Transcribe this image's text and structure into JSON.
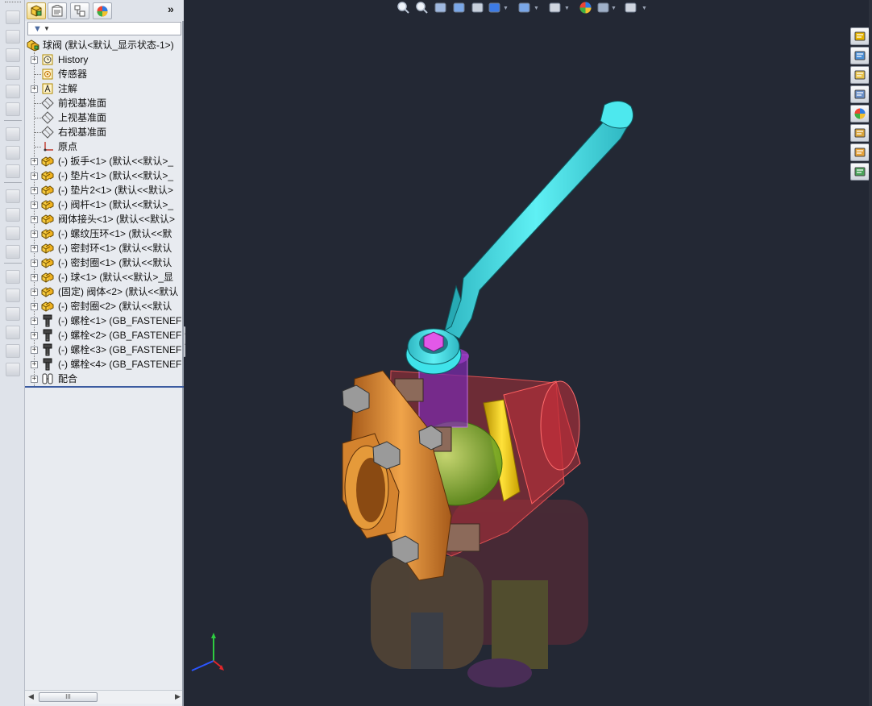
{
  "feature_manager": {
    "tabs": [
      "featuremanager-tree-icon",
      "propertymanager-icon",
      "configurationmanager-icon",
      "displaymanager-icon"
    ],
    "expand_symbol": "»",
    "filter_icon": "funnel-icon",
    "root": "球阀 (默认<默认_显示状态-1>)",
    "items": [
      {
        "label": "History",
        "icon": "history-icon",
        "expandable": true
      },
      {
        "label": "传感器",
        "icon": "sensor-icon",
        "expandable": false
      },
      {
        "label": "注解",
        "icon": "annotation-icon",
        "expandable": true
      },
      {
        "label": "前视基准面",
        "icon": "plane-icon",
        "expandable": false
      },
      {
        "label": "上视基准面",
        "icon": "plane-icon",
        "expandable": false
      },
      {
        "label": "右视基准面",
        "icon": "plane-icon",
        "expandable": false
      },
      {
        "label": "原点",
        "icon": "origin-icon",
        "expandable": false
      },
      {
        "label": "(-) 扳手<1> (默认<<默认>_",
        "icon": "part-icon",
        "expandable": true
      },
      {
        "label": "(-) 垫片<1> (默认<<默认>_",
        "icon": "part-icon",
        "expandable": true
      },
      {
        "label": "(-) 垫片2<1> (默认<<默认>",
        "icon": "part-icon",
        "expandable": true
      },
      {
        "label": "(-) 阀杆<1> (默认<<默认>_",
        "icon": "part-icon",
        "expandable": true
      },
      {
        "label": "阀体接头<1> (默认<<默认>",
        "icon": "part-icon",
        "expandable": true
      },
      {
        "label": "(-) 螺纹压环<1> (默认<<默",
        "icon": "part-icon",
        "expandable": true
      },
      {
        "label": "(-) 密封环<1> (默认<<默认",
        "icon": "part-icon",
        "expandable": true
      },
      {
        "label": "(-) 密封圈<1> (默认<<默认",
        "icon": "part-icon",
        "expandable": true
      },
      {
        "label": "(-) 球<1> (默认<<默认>_显",
        "icon": "part-icon",
        "expandable": true
      },
      {
        "label": "(固定) 阀体<2> (默认<<默认",
        "icon": "part-icon",
        "expandable": true
      },
      {
        "label": "(-) 密封圈<2> (默认<<默认",
        "icon": "part-icon",
        "expandable": true
      },
      {
        "label": "(-) 螺栓<1> (GB_FASTENEF",
        "icon": "bolt-icon",
        "expandable": true
      },
      {
        "label": "(-) 螺栓<2> (GB_FASTENEF",
        "icon": "bolt-icon",
        "expandable": true
      },
      {
        "label": "(-) 螺栓<3> (GB_FASTENEF",
        "icon": "bolt-icon",
        "expandable": true
      },
      {
        "label": "(-) 螺栓<4> (GB_FASTENEF",
        "icon": "bolt-icon",
        "expandable": true
      },
      {
        "label": "配合",
        "icon": "mates-icon",
        "expandable": true
      }
    ],
    "scroll_thumb": "III"
  },
  "view_toolbar": {
    "buttons": [
      "zoom-to-fit-icon",
      "zoom-to-area-icon",
      "previous-view-icon",
      "section-view-icon",
      "dynamic-annotation-icon",
      "view-orientation-icon",
      "display-style-icon",
      "hide-show-icon",
      "edit-appearance-icon",
      "apply-scene-icon",
      "view-settings-icon"
    ]
  },
  "task_pane": {
    "buttons": [
      "solidworks-resources-icon",
      "design-library-icon",
      "file-explorer-icon",
      "view-palette-icon",
      "appearances-icon",
      "custom-properties-icon",
      "open-file-icon",
      "forum-icon"
    ]
  },
  "colors": {
    "viewport_bg": "#232834",
    "handle": "#3fe3ea",
    "flange": "#e59a3a",
    "valve_body": "#c8303a",
    "ring": "#f4d21c",
    "ball": "#9bd24a",
    "stem": "#d040d0",
    "bolt": "#8c8c8c"
  }
}
